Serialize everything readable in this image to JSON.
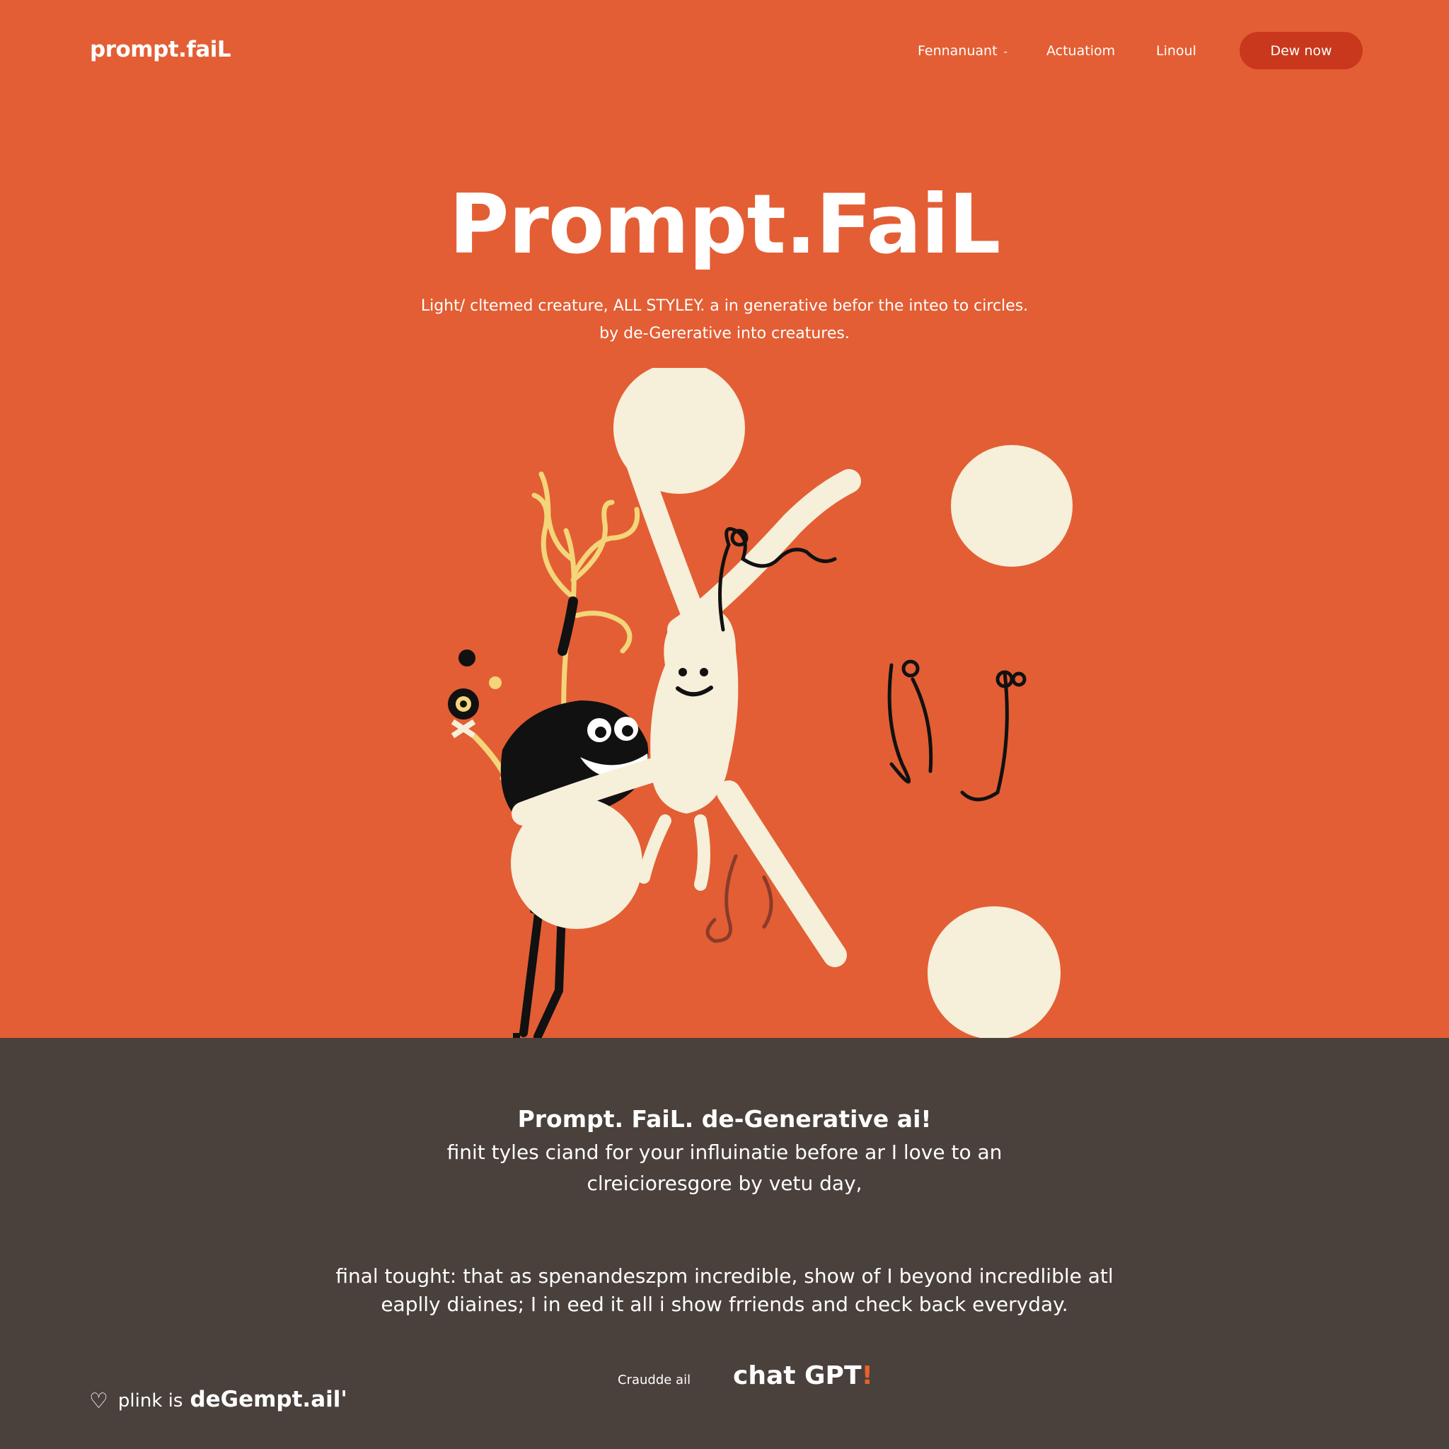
{
  "nav": {
    "logo": "prompt.faiL",
    "links": [
      {
        "label": "Fennanuant",
        "caret": "-"
      },
      {
        "label": "Actuatiom"
      },
      {
        "label": "Linoul"
      }
    ],
    "cta_label": "Dew now"
  },
  "hero": {
    "title": "Prompt.FaiL",
    "subtitle_line1": "Light/ cltemed creature, ALL STYLEY. a in generative befor the inteo to circles.",
    "subtitle_line2": "by de-Gererative into creatures."
  },
  "illustration": {
    "type": "cartoon-creatures",
    "alt": ""
  },
  "content": {
    "title": "Prompt. FaiL. de-Generative ai!",
    "line1": "finit tyles ciand for your influinatie before ar I love to an",
    "line2": "clreicioresgore by vetu day,",
    "final1": "final tought: that as spenandeszpm incredible, show of I beyond incredlible atl",
    "final2": "eaplly diaines; I in eed it all i show frriends and check back everyday."
  },
  "footer": {
    "brand_icon": "heart-icon",
    "brand_prefix": "plink is",
    "brand_name": "deGempt.ail'",
    "partner1": "Craudde ail",
    "partner2_main": "chat GPT",
    "partner2_accent": "!"
  },
  "colors": {
    "hero_bg": "#e35e34",
    "bottom_bg": "#4a403c",
    "cta_bg": "#c9381c",
    "cream": "#f6efd9",
    "accent": "#e8622a"
  }
}
